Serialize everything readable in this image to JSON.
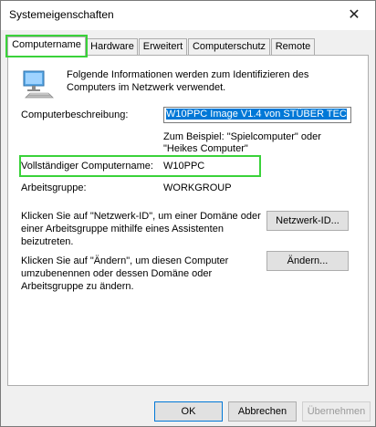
{
  "window": {
    "title": "Systemeigenschaften",
    "close_symbol": "✕"
  },
  "tabs": [
    {
      "label": "Computername",
      "active": true
    },
    {
      "label": "Hardware",
      "active": false
    },
    {
      "label": "Erweitert",
      "active": false
    },
    {
      "label": "Computerschutz",
      "active": false
    },
    {
      "label": "Remote",
      "active": false
    }
  ],
  "intro": "Folgende Informationen werden zum Identifizieren des Computers im Netzwerk verwendet.",
  "description": {
    "label": "Computerbeschreibung:",
    "value": "W10PPC Image V1.4 von STÜBER TEC",
    "example": "Zum Beispiel: \"Spielcomputer\" oder \"Heikes Computer\""
  },
  "full_name": {
    "label": "Vollständiger Computername:",
    "value": "W10PPC"
  },
  "workgroup": {
    "label": "Arbeitsgruppe:",
    "value": "WORKGROUP"
  },
  "network_id": {
    "text": "Klicken Sie auf \"Netzwerk-ID\", um einer Domäne oder einer Arbeitsgruppe mithilfe eines Assistenten beizutreten.",
    "button": "Netzwerk-ID..."
  },
  "change": {
    "text": "Klicken Sie auf \"Ändern\", um diesen Computer umzubenennen oder dessen Domäne oder Arbeitsgruppe zu ändern.",
    "button": "Ändern..."
  },
  "footer": {
    "ok": "OK",
    "cancel": "Abbrechen",
    "apply": "Übernehmen"
  },
  "colors": {
    "highlight": "#3ad23a",
    "selection": "#0078d7"
  }
}
